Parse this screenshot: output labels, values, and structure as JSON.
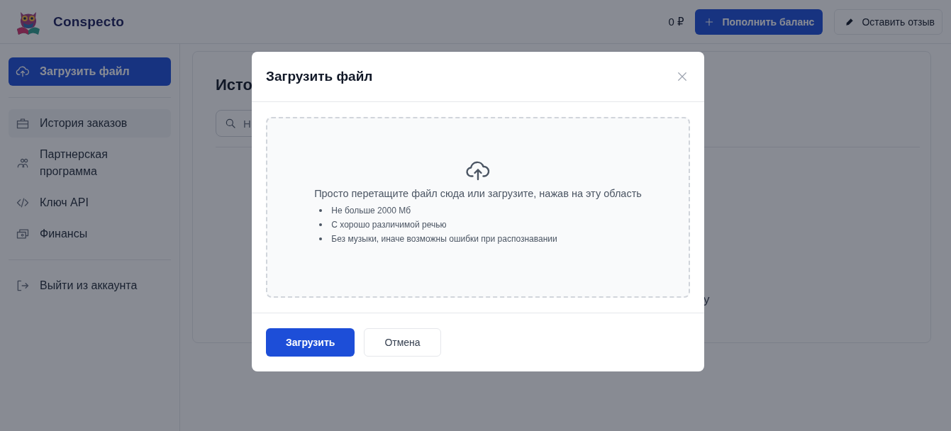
{
  "header": {
    "brand": "Conspecto",
    "balance": "0 ₽",
    "topup_button": "Пополнить баланс",
    "feedback_button": "Оставить отзыв"
  },
  "sidebar": {
    "upload_button": "Загрузить файл",
    "items": [
      {
        "label": "История заказов",
        "selected": true
      },
      {
        "label": "Партнерская программа",
        "selected": false
      },
      {
        "label": "Ключ API",
        "selected": false
      },
      {
        "label": "Финансы",
        "selected": false
      }
    ],
    "logout": "Выйти из аккаунта"
  },
  "content": {
    "heading": "Исто",
    "search": {
      "placeholder": "Н"
    },
    "empty_text": "у"
  },
  "modal": {
    "title": "Загрузить файл",
    "dropzone": {
      "text": "Просто перетащите файл сюда или загрузите, нажав на эту область",
      "rules": [
        "Не больше 2000 Мб",
        "С хорошо различимой речью",
        "Без музыки, иначе возможны ошибки при распознавании"
      ]
    },
    "buttons": [
      {
        "label": "Загрузить",
        "kind": "primary"
      },
      {
        "label": "Отмена",
        "kind": "secondary"
      }
    ]
  }
}
